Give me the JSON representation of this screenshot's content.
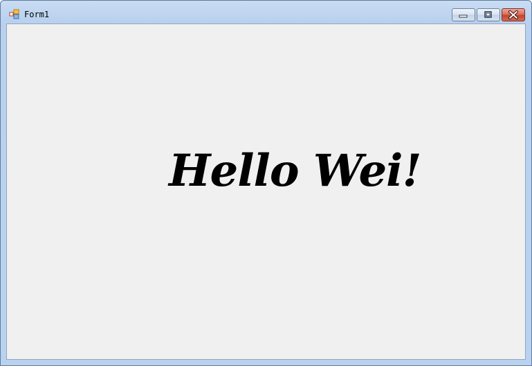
{
  "window": {
    "title": "Form1",
    "icon": "winforms-app-icon",
    "caption_buttons": {
      "minimize_icon": "minimize-icon",
      "maximize_icon": "maximize-icon",
      "close_icon": "close-icon"
    },
    "client_background": "#f0f0f0",
    "frame_color": "#b9d1ee",
    "close_button_color": "#c6452d"
  },
  "main": {
    "label": "Hello Wei!"
  }
}
